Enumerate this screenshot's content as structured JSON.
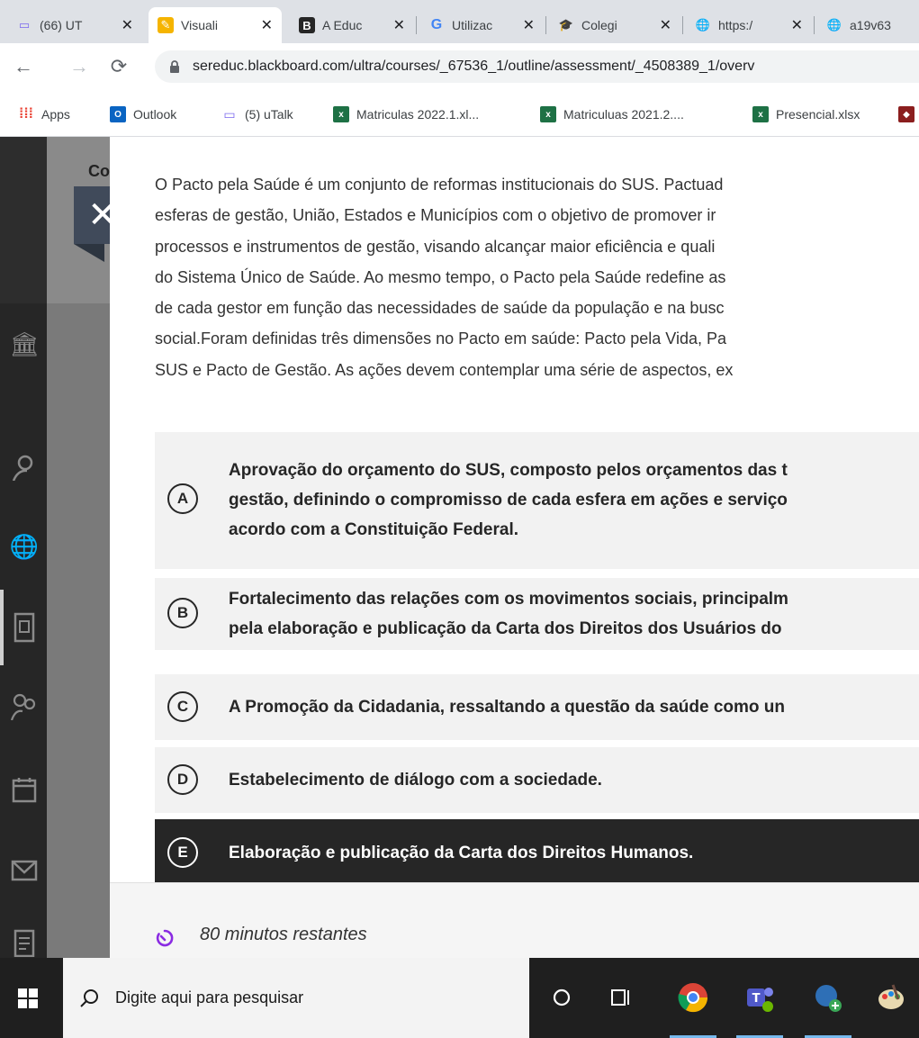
{
  "browser": {
    "tabs": [
      {
        "label": "(66) UT",
        "icon": "utalk-icon",
        "active": false
      },
      {
        "label": "Visuali",
        "icon": "pencil-icon",
        "active": true
      },
      {
        "label": "A Educ",
        "icon": "blackboard-icon",
        "active": false
      },
      {
        "label": "Utilizac",
        "icon": "google-icon",
        "active": false
      },
      {
        "label": "Colegi",
        "icon": "graduation-cap-icon",
        "active": false
      },
      {
        "label": "https:/",
        "icon": "globe-icon",
        "active": false
      },
      {
        "label": "a19v63",
        "icon": "globe-icon",
        "active": false
      }
    ],
    "url": "sereduc.blackboard.com/ultra/courses/_67536_1/outline/assessment/_4508389_1/overv",
    "bookmarks": [
      {
        "label": "Apps",
        "icon": "apps-grid-icon"
      },
      {
        "label": "Outlook",
        "icon": "outlook-icon"
      },
      {
        "label": "(5) uTalk",
        "icon": "utalk-icon"
      },
      {
        "label": "Matriculas 2022.1.xl...",
        "icon": "excel-icon"
      },
      {
        "label": "Matriculuas 2021.2....",
        "icon": "excel-icon"
      },
      {
        "label": "Presencial.xlsx",
        "icon": "excel-icon"
      }
    ]
  },
  "gutter": {
    "label": "Co"
  },
  "question": {
    "lines": [
      "O Pacto pela Saúde é um conjunto de reformas institucionais do SUS. Pactuad",
      "esferas de gestão, União, Estados e Municípios com o objetivo de promover ir",
      "processos e instrumentos de gestão, visando alcançar maior eficiência e quali",
      "do Sistema Único de Saúde. Ao mesmo tempo, o Pacto pela Saúde redefine as",
      "de cada gestor em função das necessidades de saúde da população e na busc",
      "social.Foram definidas três dimensões no Pacto em saúde: Pacto pela Vida, Pa",
      "SUS e Pacto de Gestão. As ações devem contemplar uma série de aspectos, ex"
    ]
  },
  "options": [
    {
      "letter": "A",
      "lines": [
        "Aprovação do orçamento do SUS, composto pelos orçamentos das t",
        "gestão, definindo o compromisso de cada esfera em ações e serviço",
        "acordo com a Constituição Federal."
      ],
      "selected": false
    },
    {
      "letter": "B",
      "lines": [
        "Fortalecimento das relações com os movimentos sociais, principalm",
        "pela elaboração e publicação da Carta dos Direitos dos Usuários do"
      ],
      "selected": false
    },
    {
      "letter": "C",
      "lines": [
        "A Promoção da Cidadania, ressaltando a questão da saúde como un"
      ],
      "selected": false
    },
    {
      "letter": "D",
      "lines": [
        "Estabelecimento de diálogo com a sociedade."
      ],
      "selected": false
    },
    {
      "letter": "E",
      "lines": [
        "Elaboração e publicação da Carta dos Direitos Humanos."
      ],
      "selected": true
    }
  ],
  "timer": {
    "text": "80 minutos restantes"
  },
  "taskbar": {
    "search_placeholder": "Digite aqui para pesquisar"
  }
}
